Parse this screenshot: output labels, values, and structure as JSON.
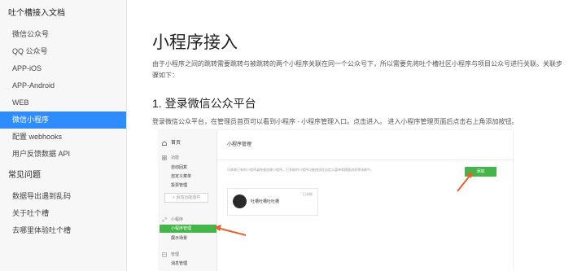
{
  "sidebar": {
    "section_docs": "吐个槽接入文档",
    "docs_items": [
      "微信公众号",
      "QQ 公众号",
      "APP-iOS",
      "APP-Android",
      "WEB",
      "微信小程序",
      "配置 webhooks",
      "用户反馈数据 API"
    ],
    "active_index": 5,
    "section_faq": "常见问题",
    "faq_items": [
      "数据导出遇到乱码",
      "关于吐个槽",
      "去哪里体验吐个槽"
    ]
  },
  "main": {
    "title": "小程序接入",
    "intro": "由于小程序之间的跳转需要跳转与被跳转的两个小程序关联在同一个公众号下，所以需要先将吐个槽社区小程序与项目公众号进行关联。关联步骤如下：",
    "section1_title": "1. 登录微信公众平台",
    "section1_desc": "登录微信公众平台，在管理员首页可以看到小程序 - 小程序管理入口。点击进入。 进入小程序管理页面后点击右上角添加按钮。"
  },
  "embedded_screenshot": {
    "nav": {
      "home": "首页",
      "group_features": "功能",
      "feature_items": [
        "自动回复",
        "自定义菜单",
        "投票管理"
      ],
      "add_plugin": "+ 添加功能插件",
      "group_miniprogram": "小程序",
      "miniprogram_items": [
        "小程序管理",
        "展示场景"
      ],
      "group_manage": "管理",
      "manage_items": [
        "消息管理"
      ]
    },
    "header_title": "小程序管理",
    "note": "可关联已有的小程序或快速创建小程序。已关联的小程序可被使用在自定义菜单和模版消息等场景中。",
    "add_button": "添加",
    "card": {
      "name": "吐槽吐槽吐吐槽",
      "status": "已关联"
    },
    "colors": {
      "green": "#44b549",
      "arrow": "#e8632b"
    }
  },
  "colors": {
    "active_blue": "#2f8cff"
  }
}
